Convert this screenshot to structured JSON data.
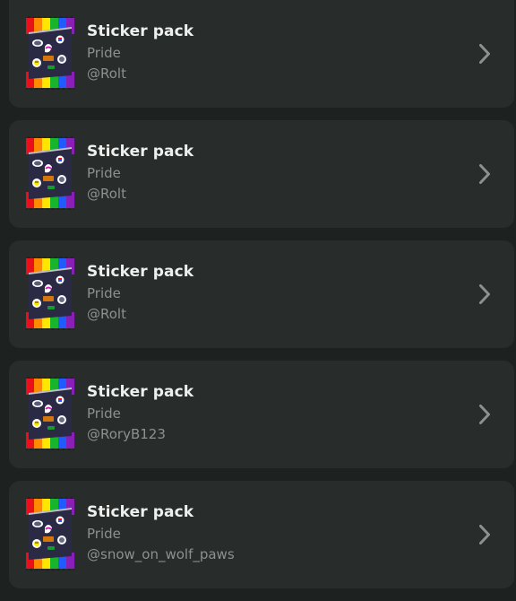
{
  "colors": {
    "background": "#1d211f",
    "card": "#282c2a",
    "title": "#eef0ee",
    "muted": "#8c918e"
  },
  "items": [
    {
      "title": "Sticker pack",
      "subtitle": "Pride",
      "author": "@Rolt",
      "thumbnail_icon": "pride-sticker-pack-icon",
      "action_icon": "chevron-right-icon"
    },
    {
      "title": "Sticker pack",
      "subtitle": "Pride",
      "author": "@Rolt",
      "thumbnail_icon": "pride-sticker-pack-icon",
      "action_icon": "chevron-right-icon"
    },
    {
      "title": "Sticker pack",
      "subtitle": "Pride",
      "author": "@Rolt",
      "thumbnail_icon": "pride-sticker-pack-icon",
      "action_icon": "chevron-right-icon"
    },
    {
      "title": "Sticker pack",
      "subtitle": "Pride",
      "author": "@RoryB123",
      "thumbnail_icon": "pride-sticker-pack-icon",
      "action_icon": "chevron-right-icon"
    },
    {
      "title": "Sticker pack",
      "subtitle": "Pride",
      "author": "@snow_on_wolf_paws",
      "thumbnail_icon": "pride-sticker-pack-icon",
      "action_icon": "chevron-right-icon"
    }
  ]
}
